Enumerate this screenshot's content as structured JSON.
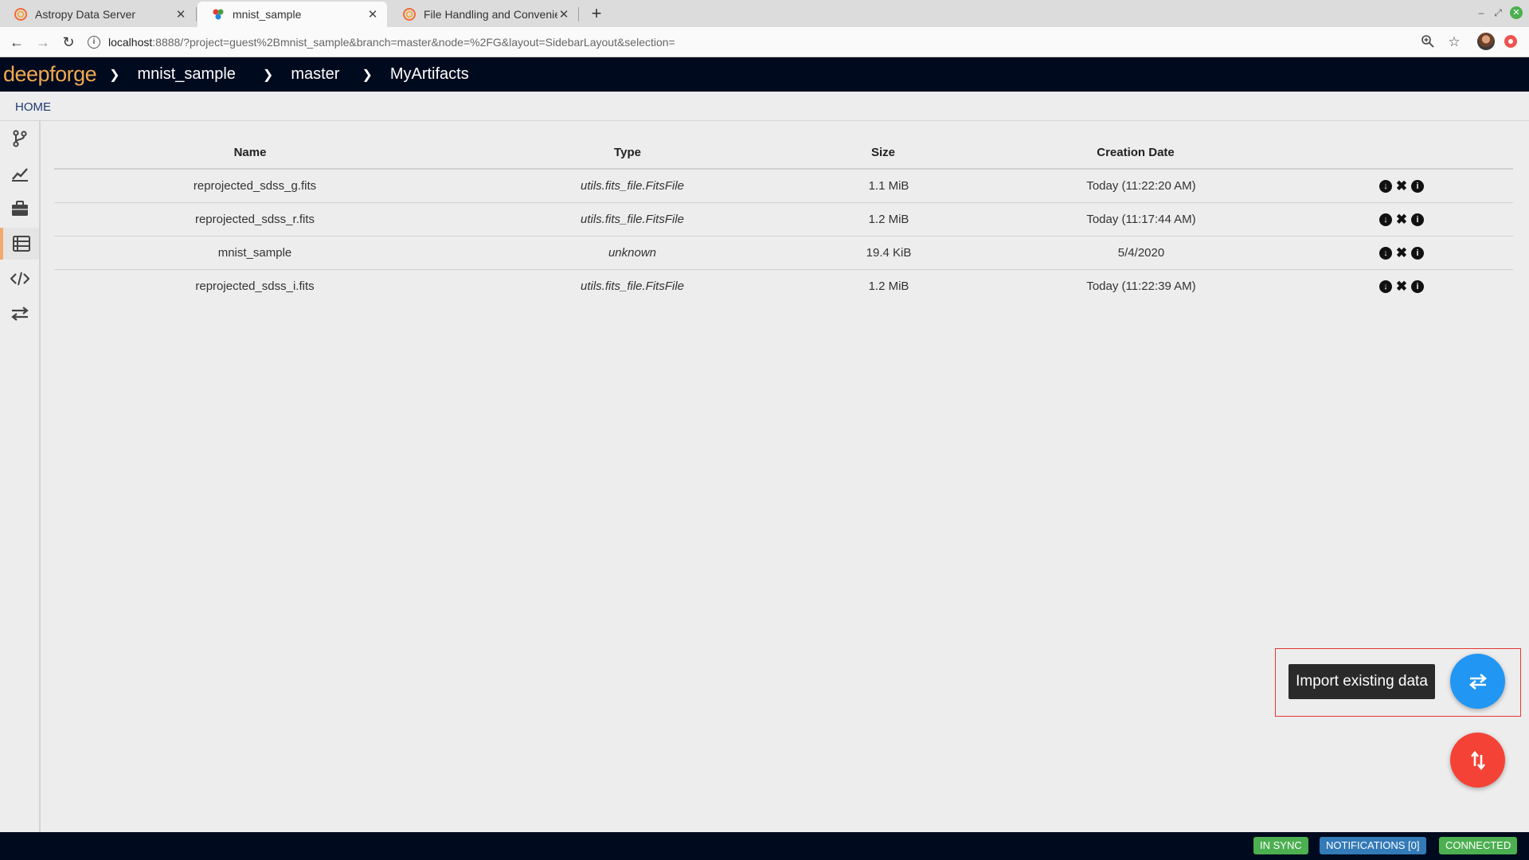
{
  "browser": {
    "tabs": [
      {
        "title": "Astropy Data Server",
        "favicon": "astropy-icon",
        "active": false
      },
      {
        "title": "mnist_sample",
        "favicon": "deepforge-icon",
        "active": true
      },
      {
        "title": "File Handling and Convenience",
        "favicon": "astropy-icon",
        "active": false
      }
    ],
    "url_host": "localhost",
    "url_rest": ":8888/?project=guest%2Bmnist_sample&branch=master&node=%2FG&layout=SidebarLayout&selection="
  },
  "app": {
    "logo": "deepforge",
    "breadcrumbs": [
      "mnist_sample",
      "master",
      "MyArtifacts"
    ],
    "home_label": "HOME"
  },
  "sidebar": {
    "items": [
      {
        "icon": "branch-icon"
      },
      {
        "icon": "line-chart-icon"
      },
      {
        "icon": "briefcase-icon"
      },
      {
        "icon": "list-icon",
        "active": true
      },
      {
        "icon": "code-icon"
      },
      {
        "icon": "transfer-icon"
      }
    ]
  },
  "table": {
    "headers": [
      "Name",
      "Type",
      "Size",
      "Creation Date"
    ],
    "rows": [
      {
        "name": "reprojected_sdss_g.fits",
        "type": "utils.fits_file.FitsFile",
        "size": "1.1 MiB",
        "date": "Today (11:22:20 AM)"
      },
      {
        "name": "reprojected_sdss_r.fits",
        "type": "utils.fits_file.FitsFile",
        "size": "1.2 MiB",
        "date": "Today (11:17:44 AM)"
      },
      {
        "name": "mnist_sample",
        "type": "unknown",
        "size": "19.4 KiB",
        "date": "5/4/2020"
      },
      {
        "name": "reprojected_sdss_i.fits",
        "type": "utils.fits_file.FitsFile",
        "size": "1.2 MiB",
        "date": "Today (11:22:39 AM)"
      }
    ]
  },
  "fab": {
    "tooltip": "Import existing data",
    "primary_color": "#2196f3",
    "secondary_color": "#f44336"
  },
  "status": {
    "sync": "IN SYNC",
    "notifications": "NOTIFICATIONS [0]",
    "connection": "CONNECTED"
  }
}
